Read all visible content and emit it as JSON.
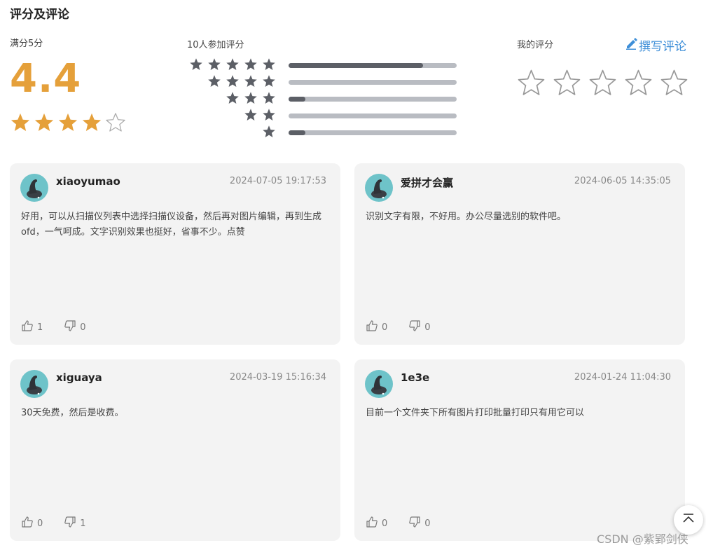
{
  "header": {
    "title": "评分及评论"
  },
  "rating": {
    "full_label": "满分5分",
    "average": "4.4",
    "stars_filled": 4,
    "stars_total": 5,
    "participants_label": "10人参加评分",
    "distribution": [
      {
        "stars": 5,
        "fraction": 0.8
      },
      {
        "stars": 4,
        "fraction": 0.0
      },
      {
        "stars": 3,
        "fraction": 0.1
      },
      {
        "stars": 2,
        "fraction": 0.0
      },
      {
        "stars": 1,
        "fraction": 0.1
      }
    ]
  },
  "my_rating": {
    "label": "我的评分",
    "write_label": "撰写评论",
    "stars": 5
  },
  "reviews": [
    {
      "user": "xiaoyumao",
      "date": "2024-07-05 19:17:53",
      "content": "好用，可以从扫描仪列表中选择扫描仪设备，然后再对图片编辑，再到生成ofd，一气呵成。文字识别效果也挺好，省事不少。点赞",
      "likes": "1",
      "dislikes": "0"
    },
    {
      "user": "爱拼才会赢",
      "date": "2024-06-05 14:35:05",
      "content": "识别文字有限，不好用。办公尽量选别的软件吧。",
      "likes": "0",
      "dislikes": "0"
    },
    {
      "user": "xiguaya",
      "date": "2024-03-19 15:16:34",
      "content": "30天免费，然后是收费。",
      "likes": "0",
      "dislikes": "1"
    },
    {
      "user": "1e3e",
      "date": "2024-01-24 11:04:30",
      "content": "目前一个文件夹下所有图片打印批量打印只有用它可以",
      "likes": "0",
      "dislikes": "0"
    }
  ],
  "colors": {
    "accent_gold": "#e5a03a",
    "link_blue": "#3f8fd8",
    "bar_fill": "#5c5f66",
    "bar_track": "#b9bcc2",
    "card_bg": "#f3f3f3"
  },
  "icons": {
    "back_to_top": "chevron-up-icon",
    "like": "thumbs-up-icon",
    "dislike": "thumbs-down-icon",
    "write": "pencil-icon"
  },
  "watermark": "CSDN @紫郢剑侠"
}
